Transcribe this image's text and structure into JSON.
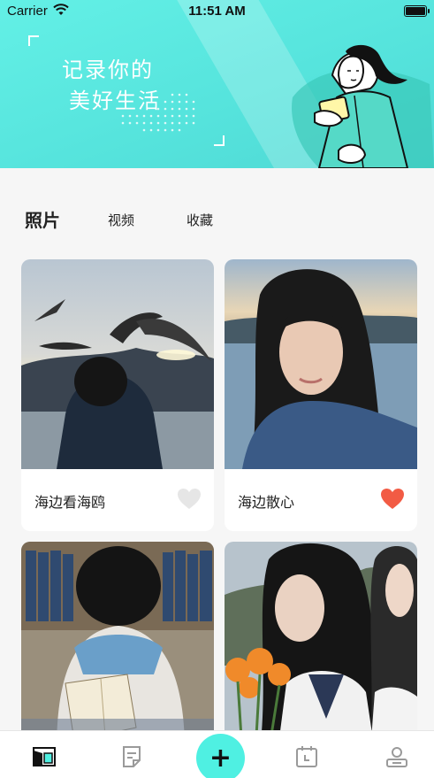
{
  "status_bar": {
    "carrier": "Carrier",
    "time": "11:51 AM"
  },
  "banner": {
    "slogan_line1": "记录你的",
    "slogan_line2": "美好生活"
  },
  "tabs": [
    {
      "label": "照片",
      "active": true
    },
    {
      "label": "视频",
      "active": false
    },
    {
      "label": "收藏",
      "active": false
    }
  ],
  "cards": [
    {
      "title": "海边看海鸥",
      "liked": false,
      "heart_color": "#e6e6e6"
    },
    {
      "title": "海边散心",
      "liked": true,
      "heart_color": "#f25b44"
    },
    {
      "title": "",
      "liked": false
    },
    {
      "title": "",
      "liked": false
    }
  ],
  "bottom_nav": {
    "items": [
      "album-icon",
      "note-icon",
      "add-icon",
      "calendar-icon",
      "profile-icon"
    ],
    "plus_label": "+"
  },
  "colors": {
    "accent": "#4ff0e2",
    "banner": "#5fe9df",
    "liked": "#f25b44"
  }
}
